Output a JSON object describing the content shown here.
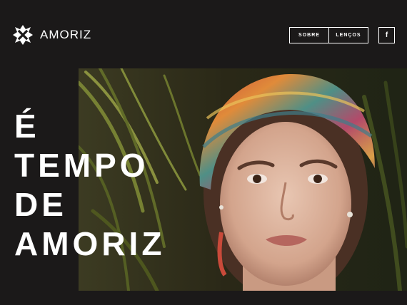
{
  "brand": {
    "name": "AMORIZ",
    "logo_icon": "amoriz-star-logo-icon"
  },
  "nav": {
    "items": [
      {
        "label": "SOBRE"
      },
      {
        "label": "LENÇOS"
      }
    ],
    "facebook_label": "f",
    "facebook_icon": "facebook-icon"
  },
  "hero": {
    "headline_lines": [
      "É",
      "TEMPO",
      "DE",
      "AMORIZ"
    ],
    "image": "woman-with-colorful-headscarf-photo"
  },
  "colors": {
    "background": "#1b1919",
    "text": "#ffffff"
  }
}
